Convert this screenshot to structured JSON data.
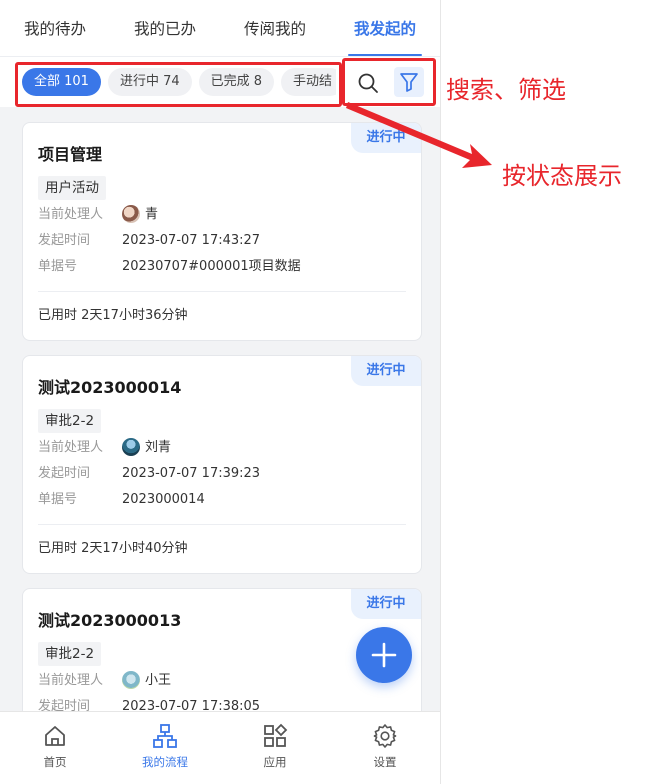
{
  "top_tabs": [
    {
      "label": "我的待办"
    },
    {
      "label": "我的已办"
    },
    {
      "label": "传阅我的"
    },
    {
      "label": "我发起的"
    }
  ],
  "active_tab": "我发起的",
  "filter_chips": [
    {
      "label": "全部 101"
    },
    {
      "label": "进行中 74"
    },
    {
      "label": "已完成 8"
    },
    {
      "label": "手动结"
    }
  ],
  "active_chip": "全部 101",
  "icons": {
    "search": "search-icon",
    "filter": "filter-icon",
    "add": "plus-icon"
  },
  "field_labels": {
    "handler": "当前处理人",
    "start_time": "发起时间",
    "doc_no": "单据号"
  },
  "cards": [
    {
      "title": "项目管理",
      "status": "进行中",
      "node": "用户活动",
      "handler": "青",
      "start_time": "2023-07-07 17:43:27",
      "doc_no": "20230707#000001项目数据",
      "used_time": "已用时 2天17小时36分钟"
    },
    {
      "title": "测试2023000014",
      "status": "进行中",
      "node": "审批2-2",
      "handler": "刘青",
      "start_time": "2023-07-07 17:39:23",
      "doc_no": "2023000014",
      "used_time": "已用时 2天17小时40分钟"
    },
    {
      "title": "测试2023000013",
      "status": "进行中",
      "node": "审批2-2",
      "handler": "小王",
      "start_time": "2023-07-07 17:38:05"
    }
  ],
  "bottom_nav": [
    {
      "label": "首页",
      "icon": "home-icon"
    },
    {
      "label": "我的流程",
      "icon": "flow-icon"
    },
    {
      "label": "应用",
      "icon": "apps-icon"
    },
    {
      "label": "设置",
      "icon": "settings-icon"
    }
  ],
  "active_nav": "我的流程",
  "annotations": {
    "search_filter": "搜索、筛选",
    "by_status": "按状态展示"
  },
  "colors": {
    "accent": "#3a77e8",
    "annotation": "#e8262c",
    "background": "#f2f3f5"
  }
}
